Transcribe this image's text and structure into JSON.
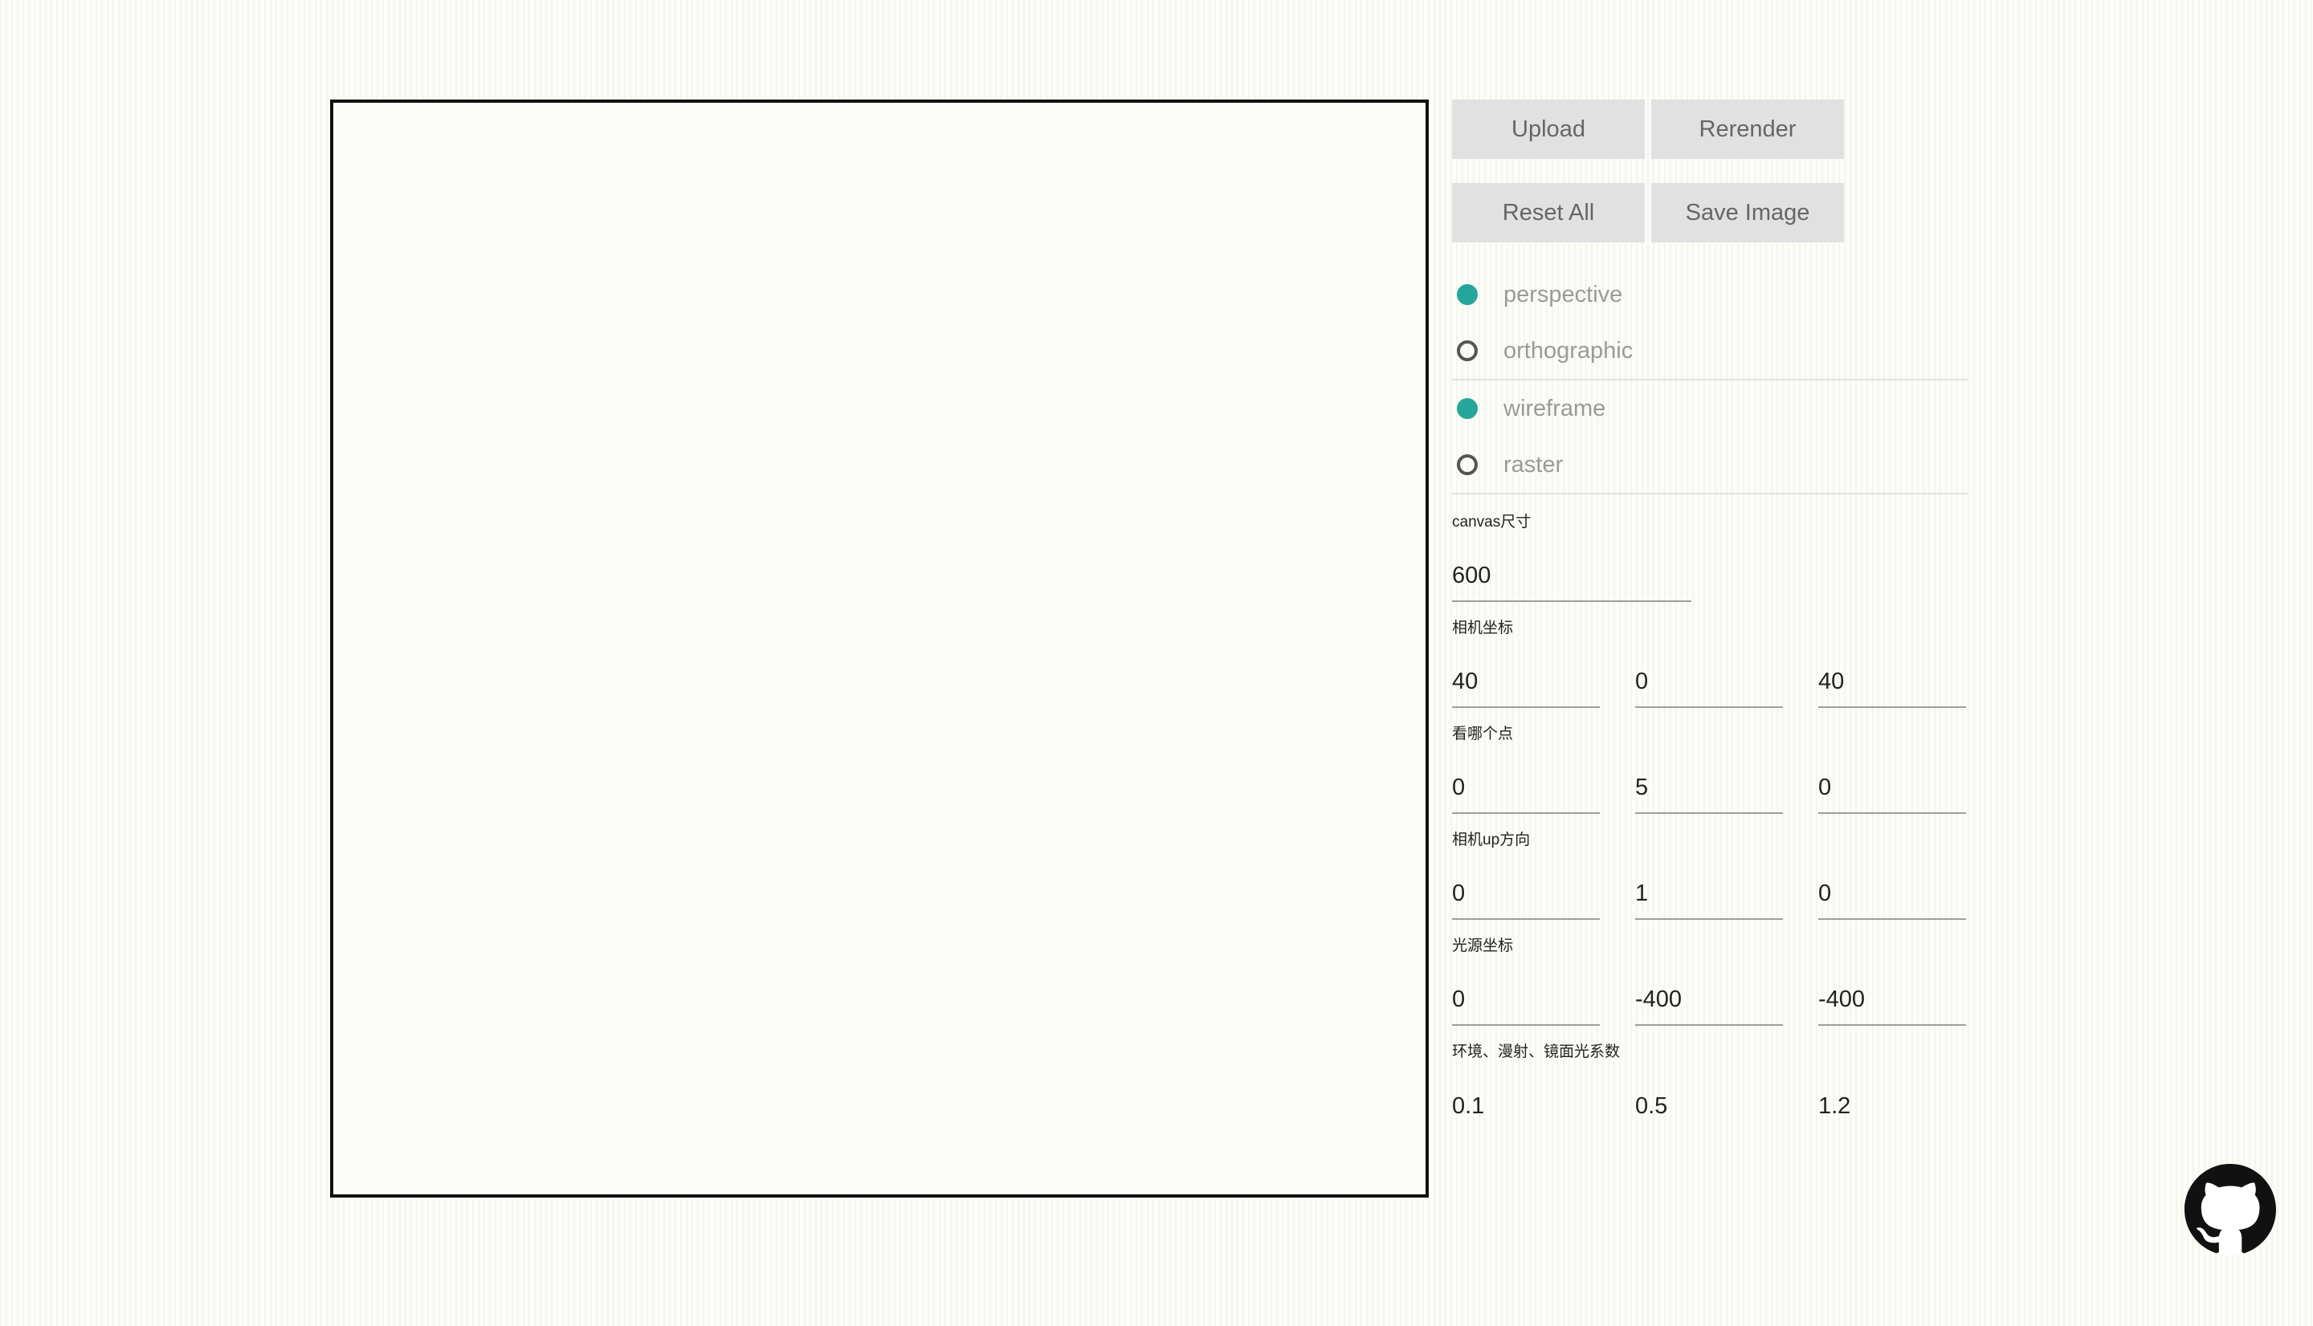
{
  "toolbar": {
    "upload_label": "Upload",
    "rerender_label": "Rerender",
    "reset_label": "Reset All",
    "save_label": "Save Image"
  },
  "projection": {
    "options": [
      {
        "label": "perspective",
        "checked": true
      },
      {
        "label": "orthographic",
        "checked": false
      }
    ]
  },
  "render_mode": {
    "options": [
      {
        "label": "wireframe",
        "checked": true
      },
      {
        "label": "raster",
        "checked": false
      }
    ]
  },
  "canvas_size": {
    "label": "canvas尺寸",
    "value": "600"
  },
  "camera_position": {
    "label": "相机坐标",
    "x": "40",
    "y": "0",
    "z": "40"
  },
  "look_at": {
    "label": "看哪个点",
    "x": "0",
    "y": "5",
    "z": "0"
  },
  "camera_up": {
    "label": "相机up方向",
    "x": "0",
    "y": "1",
    "z": "0"
  },
  "light_position": {
    "label": "光源坐标",
    "x": "0",
    "y": "-400",
    "z": "-400"
  },
  "light_coefficients": {
    "label": "环境、漫射、镜面光系数",
    "ambient": "0.1",
    "diffuse": "0.5",
    "specular": "1.2"
  },
  "colors": {
    "accent": "#26a69a",
    "button_bg": "#e1e1e1",
    "button_text": "#666666",
    "radio_label": "#9a9a9a"
  },
  "icons": {
    "github": "github-icon"
  }
}
